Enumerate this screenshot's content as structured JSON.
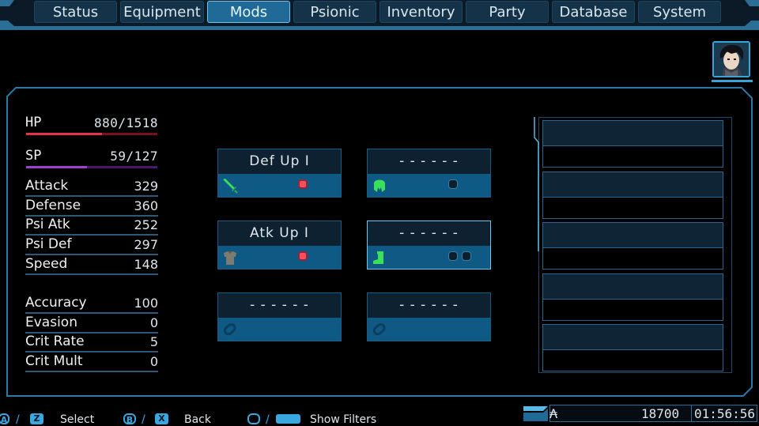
{
  "tabs": [
    {
      "label": "Status",
      "active": false
    },
    {
      "label": "Equipment",
      "active": false
    },
    {
      "label": "Mods",
      "active": true
    },
    {
      "label": "Psionic",
      "active": false
    },
    {
      "label": "Inventory",
      "active": false
    },
    {
      "label": "Party",
      "active": false
    },
    {
      "label": "Database",
      "active": false
    },
    {
      "label": "System",
      "active": false
    }
  ],
  "character": {
    "portrait_icon": "character-portrait",
    "hp": {
      "label": "HP",
      "current": 880,
      "max": 1518,
      "display": "880/1518",
      "color": "#e8324a",
      "track_color": "#7a1020"
    },
    "sp": {
      "label": "SP",
      "current": 59,
      "max": 127,
      "display": "59/127",
      "color": "#a23ec9",
      "track_color": "#4a1870"
    },
    "stats_primary": [
      {
        "label": "Attack",
        "value": "329"
      },
      {
        "label": "Defense",
        "value": "360"
      },
      {
        "label": "Psi Atk",
        "value": "252"
      },
      {
        "label": "Psi Def",
        "value": "297"
      },
      {
        "label": "Speed",
        "value": "148"
      }
    ],
    "stats_secondary": [
      {
        "label": "Accuracy",
        "value": "100"
      },
      {
        "label": "Evasion",
        "value": "0"
      },
      {
        "label": "Crit Rate",
        "value": "5"
      },
      {
        "label": "Crit Mult",
        "value": "0"
      }
    ]
  },
  "mod_slots": [
    {
      "name": "Def Up I",
      "equip_icon": "sword-icon",
      "icon_color": "#39e05a",
      "sockets": [
        "filled"
      ],
      "selected": false
    },
    {
      "name": "- - - - - -",
      "equip_icon": "helmet-icon",
      "icon_color": "#39e05a",
      "sockets": [
        "empty"
      ],
      "selected": false
    },
    {
      "name": "Atk Up I",
      "equip_icon": "armor-icon",
      "icon_color": "#7d7a72",
      "sockets": [
        "filled"
      ],
      "selected": false
    },
    {
      "name": "- - - - - -",
      "equip_icon": "boot-icon",
      "icon_color": "#39e05a",
      "sockets": [
        "empty",
        "empty"
      ],
      "selected": true
    },
    {
      "name": "- - - - - -",
      "equip_icon": "accessory-icon",
      "icon_color": "#0b3e5e",
      "sockets": [],
      "selected": false
    },
    {
      "name": "- - - - - -",
      "equip_icon": "accessory-icon",
      "icon_color": "#0b3e5e",
      "sockets": [],
      "selected": false
    }
  ],
  "mod_list": {
    "items": [
      {},
      {},
      {},
      {},
      {}
    ]
  },
  "footer": {
    "hints": [
      {
        "keys": [
          "A",
          "Z"
        ],
        "label": "Select"
      },
      {
        "keys": [
          "B",
          "X"
        ],
        "label": "Back"
      },
      {
        "keys": [
          "view",
          "space"
        ],
        "label": "Show Filters"
      }
    ],
    "currency_symbol": "₳",
    "currency": "18700",
    "playtime": "01:56:56"
  }
}
